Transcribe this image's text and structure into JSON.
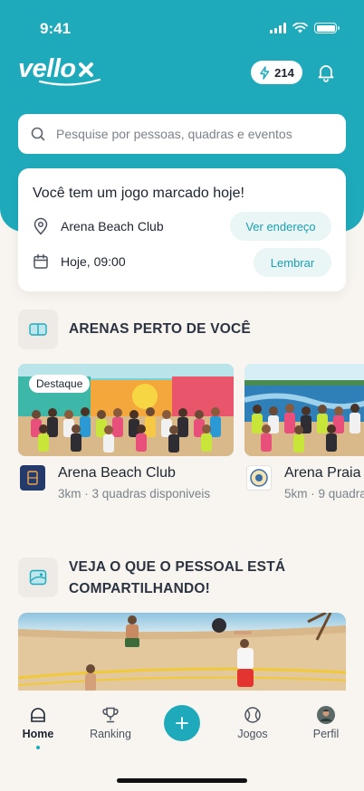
{
  "status_bar": {
    "time": "9:41"
  },
  "header": {
    "logo_text": "vello",
    "points": "214",
    "search_placeholder": "Pesquise por pessoas, quadras e eventos"
  },
  "game_card": {
    "title": "Você tem um jogo marcado hoje!",
    "location": "Arena Beach Club",
    "location_button": "Ver endereço",
    "time": "Hoje, 09:00",
    "remind_button": "Lembrar"
  },
  "arenas_section": {
    "title": "ARENAS PERTO DE VOCÊ",
    "arenas": [
      {
        "badge": "Destaque",
        "name": "Arena Beach Club",
        "distance": "3km",
        "courts": "3 quadras disponiveis"
      },
      {
        "badge": "",
        "name": "Arena Praia C",
        "distance": "5km",
        "courts": "9 quadra"
      }
    ]
  },
  "share_section": {
    "title_line1": "VEJA O QUE O PESSOAL ESTÁ",
    "title_line2": "COMPARTILHANDO!"
  },
  "bottom_nav": {
    "items": [
      {
        "label": "Home",
        "icon": "home-icon",
        "active": true
      },
      {
        "label": "Ranking",
        "icon": "trophy-icon",
        "active": false
      },
      {
        "label": "Jogos",
        "icon": "ball-icon",
        "active": false
      },
      {
        "label": "Perfil",
        "icon": "avatar-icon",
        "active": false
      }
    ]
  },
  "colors": {
    "brand": "#1faabb",
    "background": "#f8f5f0",
    "accent_text": "#1b9fb1"
  }
}
